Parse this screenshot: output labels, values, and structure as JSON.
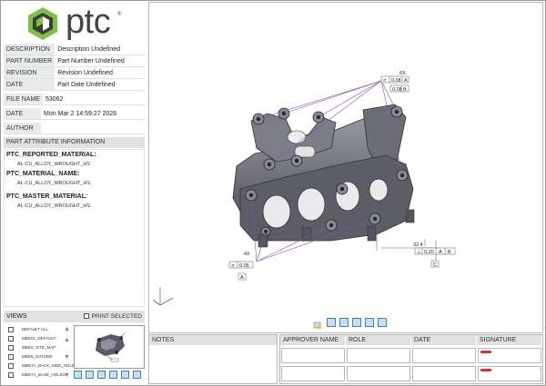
{
  "logo": {
    "text": "ptc",
    "reg": "®"
  },
  "meta": [
    {
      "key": "DESCRIPTION",
      "value": "Description Undefined"
    },
    {
      "key": "PART NUMBER",
      "value": "Part Number Undefined"
    },
    {
      "key": "REVISION",
      "value": "Revision Undefined"
    },
    {
      "key": "DATE",
      "value": "Part Date Undefined"
    }
  ],
  "file": [
    {
      "key": "FILE NAME",
      "value": "53062"
    },
    {
      "key": "DATE",
      "value": "Mon Mar  2 14:59:27 2026"
    },
    {
      "key": "AUTHOR",
      "value": ""
    }
  ],
  "part_attr_header": "PART ATTRIBUTE INFORMATION",
  "attributes": [
    {
      "name": "PTC_REPORTED_MATERIAL:",
      "value": "AL-CU_ALLOY_WROUGHT_HS"
    },
    {
      "name": "PTC_MATERIAL_NAME:",
      "value": "AL-CU_ALLOY_WROUGHT_HS"
    },
    {
      "name": "PTC_MASTER_MATERIAL:",
      "value": "AL-CU_ALLOY_WROUGHT_HS"
    }
  ],
  "views": {
    "header": "VIEWS",
    "print_selected": "PRINT SELECTED",
    "items": [
      "DEFAULT ALL",
      "MBD01_DEFAULT",
      "MBD2_SITE_MAP",
      "MBD6_DATUMS",
      "MBD7A_BACK_SIDE_HOLE",
      "MBD7A_BASE_HOLES"
    ]
  },
  "annotations": {
    "top_count": "6X",
    "top_fcf": [
      "⌭",
      "0.08",
      "A"
    ],
    "top_datum": [
      "0.08",
      "B"
    ],
    "left_count": "4X",
    "left_fcf": [
      "⌭",
      "0.05"
    ],
    "left_datum": "A",
    "right_dim": "32.4",
    "right_fcf": [
      "⊥",
      "0.20",
      "A",
      "B"
    ],
    "right_datum": "C"
  },
  "bottom": {
    "notes": "NOTES",
    "approver": "APPROVER NAME",
    "role": "ROLE",
    "date": "DATE",
    "signature": "SIGNATURE"
  }
}
